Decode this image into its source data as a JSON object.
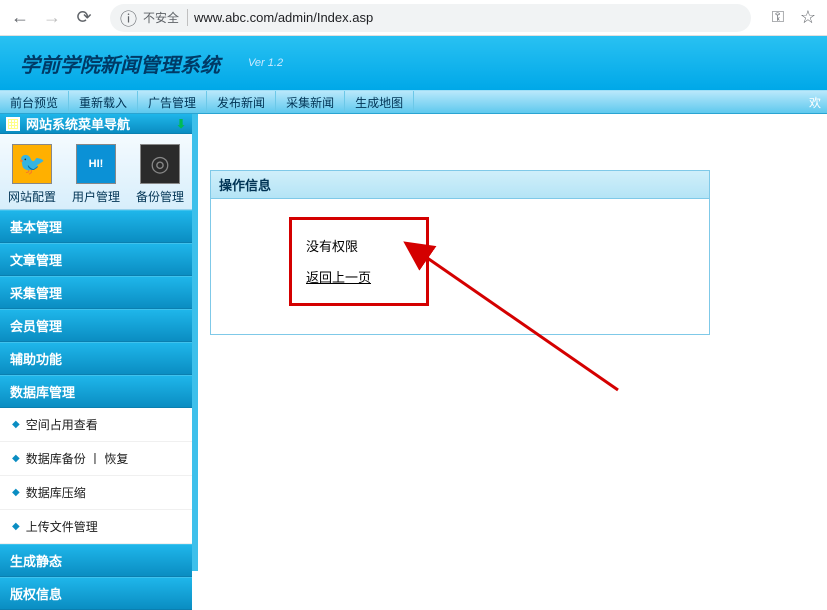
{
  "browser": {
    "security_label": "不安全",
    "url": "www.abc.com/admin/Index.asp"
  },
  "header": {
    "title": "学前学院新闻管理系统",
    "version": "Ver 1.2"
  },
  "topmenu": {
    "items": [
      "前台预览",
      "重新载入",
      "广告管理",
      "发布新闻",
      "采集新闻",
      "生成地图"
    ],
    "welcome": "欢"
  },
  "sidebar": {
    "title": "网站系统菜单导航",
    "icons": [
      {
        "label": "网站配置"
      },
      {
        "label": "用户管理"
      },
      {
        "label": "备份管理"
      }
    ],
    "groups": [
      {
        "label": "基本管理",
        "subs": []
      },
      {
        "label": "文章管理",
        "subs": []
      },
      {
        "label": "采集管理",
        "subs": []
      },
      {
        "label": "会员管理",
        "subs": []
      },
      {
        "label": "辅助功能",
        "subs": []
      },
      {
        "label": "数据库管理",
        "subs": [
          "空间占用查看",
          "数据库备份 丨 恢复",
          "数据库压缩",
          "上传文件管理"
        ]
      },
      {
        "label": "生成静态",
        "subs": []
      },
      {
        "label": "版权信息",
        "subs": []
      }
    ]
  },
  "main": {
    "panel_title": "操作信息",
    "message": "没有权限",
    "back_link": "返回上一页"
  }
}
